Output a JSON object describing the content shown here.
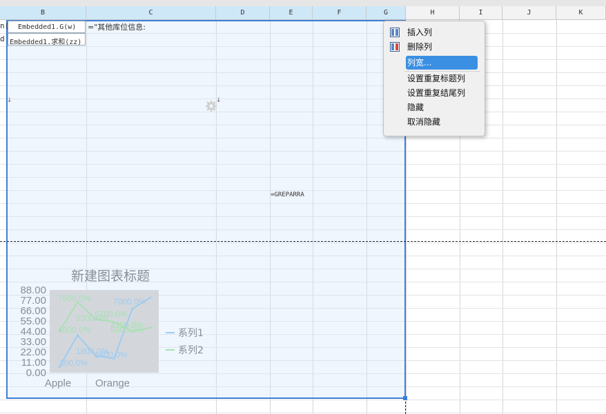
{
  "columns": [
    {
      "label": "B",
      "selected": true
    },
    {
      "label": "C",
      "selected": true
    },
    {
      "label": "D",
      "selected": true
    },
    {
      "label": "E",
      "selected": true
    },
    {
      "label": "F",
      "selected": true
    },
    {
      "label": "G",
      "selected": true
    },
    {
      "label": "H",
      "selected": false
    },
    {
      "label": "I",
      "selected": false
    },
    {
      "label": "J",
      "selected": false
    },
    {
      "label": "K",
      "selected": false
    }
  ],
  "cells": {
    "b1_formula": "Embedded1.G(w)",
    "b2_formula": "Embedded1.求和(zz)",
    "c1_text": "=\"其他库位信息:",
    "e_formula": "=GREPARRA",
    "a_clip1": "n(",
    "a_clip2": "d"
  },
  "context_menu": {
    "items": [
      {
        "label": "插入列",
        "icon": "insert-column-icon"
      },
      {
        "label": "删除列",
        "icon": "delete-column-icon"
      },
      {
        "label": "列宽...",
        "highlighted": true
      },
      {
        "label": "设置重复标题列"
      },
      {
        "label": "设置重复结尾列"
      },
      {
        "label": "隐藏"
      },
      {
        "label": "取消隐藏"
      }
    ]
  },
  "chart_data": {
    "type": "line",
    "title": "新建图表标题",
    "categories": [
      "Apple",
      "",
      "Orange",
      "",
      ""
    ],
    "x_tick_labels": [
      "Apple",
      "Orange"
    ],
    "ylim": [
      0,
      88
    ],
    "y_ticks": [
      "88.00",
      "77.00",
      "66.00",
      "55.00",
      "44.00",
      "33.00",
      "22.00",
      "11.00",
      "0.00"
    ],
    "series": [
      {
        "name": "系列1",
        "color": "#9fcbef",
        "values": [
          6,
          40,
          18,
          15,
          68,
          80
        ],
        "data_labels": [
          "300.0%",
          "1800.0%",
          "1400.0%",
          "7000.0%"
        ]
      },
      {
        "name": "系列2",
        "color": "#a9dfb3",
        "values": [
          44,
          75,
          57,
          54,
          44,
          48
        ],
        "data_labels": [
          "4000.0%",
          "7500.0%",
          "5300.0%",
          "5700.0%",
          "4300.0%",
          "5300.0%"
        ]
      }
    ],
    "legend": "right",
    "plot_background": "#d3d7dc"
  }
}
